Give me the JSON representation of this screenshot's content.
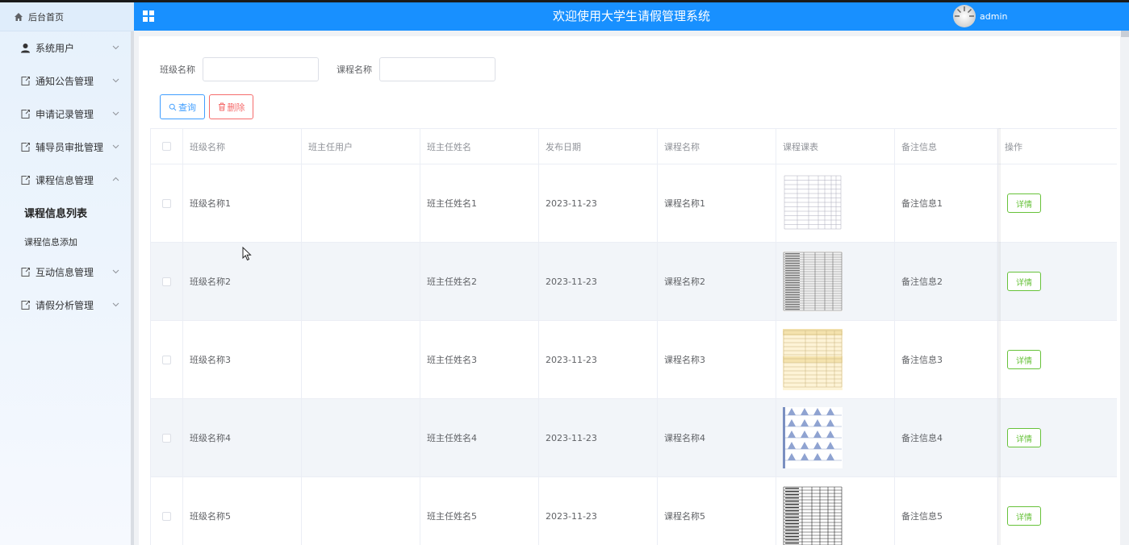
{
  "app": {
    "title": "欢迎使用大学生请假管理系统",
    "username": "admin",
    "accent_color": "#1890ff"
  },
  "sidebar": {
    "home_label": "后台首页",
    "menu": [
      {
        "label": "系统用户",
        "icon": "user-icon",
        "expanded": false
      },
      {
        "label": "通知公告管理",
        "icon": "external-link-icon",
        "expanded": false
      },
      {
        "label": "申请记录管理",
        "icon": "external-link-icon",
        "expanded": false
      },
      {
        "label": "辅导员审批管理",
        "icon": "external-link-icon",
        "expanded": false
      },
      {
        "label": "课程信息管理",
        "icon": "external-link-icon",
        "expanded": true,
        "children": [
          {
            "label": "课程信息列表",
            "active": true
          },
          {
            "label": "课程信息添加",
            "active": false
          }
        ]
      },
      {
        "label": "互动信息管理",
        "icon": "external-link-icon",
        "expanded": false
      },
      {
        "label": "请假分析管理",
        "icon": "external-link-icon",
        "expanded": false
      }
    ]
  },
  "search": {
    "class_label": "班级名称",
    "class_value": "",
    "course_label": "课程名称",
    "course_value": "",
    "query_button": "查询",
    "delete_button": "删除"
  },
  "table": {
    "columns": [
      "班级名称",
      "班主任用户",
      "班主任姓名",
      "发布日期",
      "课程名称",
      "课程课表",
      "备注信息",
      "操作"
    ],
    "detail_label": "详情",
    "rows": [
      {
        "class_name": "班级名称1",
        "teacher_user": "",
        "teacher_name": "班主任姓名1",
        "date": "2023-11-23",
        "course_name": "课程名称1",
        "schedule_style": "grid-white",
        "remark": "备注信息1"
      },
      {
        "class_name": "班级名称2",
        "teacher_user": "",
        "teacher_name": "班主任姓名2",
        "date": "2023-11-23",
        "course_name": "课程名称2",
        "schedule_style": "dense-table",
        "remark": "备注信息2"
      },
      {
        "class_name": "班级名称3",
        "teacher_user": "",
        "teacher_name": "班主任姓名3",
        "date": "2023-11-23",
        "course_name": "课程名称3",
        "schedule_style": "yellow-table",
        "remark": "备注信息3"
      },
      {
        "class_name": "班级名称4",
        "teacher_user": "",
        "teacher_name": "班主任姓名4",
        "date": "2023-11-23",
        "course_name": "课程名称4",
        "schedule_style": "blue-chart",
        "remark": "备注信息4"
      },
      {
        "class_name": "班级名称5",
        "teacher_user": "",
        "teacher_name": "班主任姓名5",
        "date": "2023-11-23",
        "course_name": "课程名称5",
        "schedule_style": "bw-table",
        "remark": "备注信息5"
      }
    ]
  }
}
